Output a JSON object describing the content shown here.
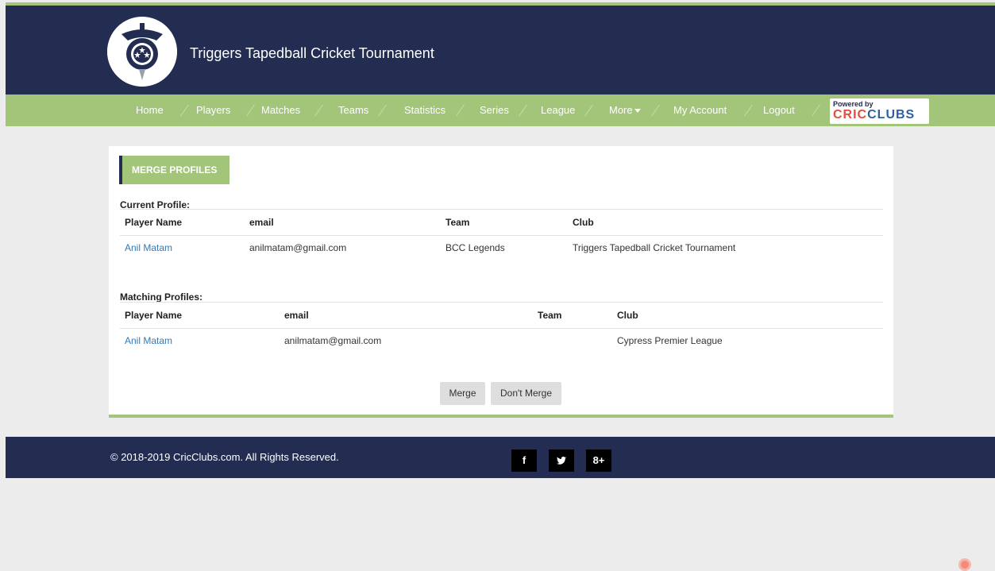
{
  "site": {
    "title": "Triggers Tapedball Cricket Tournament"
  },
  "nav": {
    "items": [
      {
        "label": "Home",
        "key": "home"
      },
      {
        "label": "Players",
        "key": "players"
      },
      {
        "label": "Matches",
        "key": "matches"
      },
      {
        "label": "Teams",
        "key": "teams"
      },
      {
        "label": "Statistics",
        "key": "statistics"
      },
      {
        "label": "Series",
        "key": "series"
      },
      {
        "label": "League",
        "key": "league"
      },
      {
        "label": "More",
        "key": "more"
      },
      {
        "label": "My Account",
        "key": "my-account"
      },
      {
        "label": "Logout",
        "key": "logout"
      }
    ],
    "powered_by": "Powered by",
    "brand_part1": "CRIC",
    "brand_part2": "CLUBS"
  },
  "merge": {
    "section_title": "MERGE PROFILES",
    "current_label": "Current Profile:",
    "matching_label": "Matching Profiles:",
    "headers": [
      "Player Name",
      "email",
      "Team",
      "Club"
    ],
    "current": {
      "player": "Anil Matam",
      "email": "anilmatam@gmail.com",
      "team": "BCC Legends",
      "club": "Triggers Tapedball Cricket Tournament"
    },
    "matching": {
      "player": "Anil Matam",
      "email": "anilmatam@gmail.com",
      "team": "",
      "club": "Cypress Premier League"
    },
    "merge_button": "Merge",
    "dont_merge_button": "Don't Merge"
  },
  "footer": {
    "copyright": "© 2018-2019 CricClubs.com. All Rights Reserved.",
    "social": {
      "facebook": "f",
      "twitter": "t",
      "googleplus": "8+"
    }
  },
  "colors": {
    "navy": "#232c51",
    "green": "#a2c57a",
    "link": "#337ab7",
    "bg": "#ececec"
  }
}
